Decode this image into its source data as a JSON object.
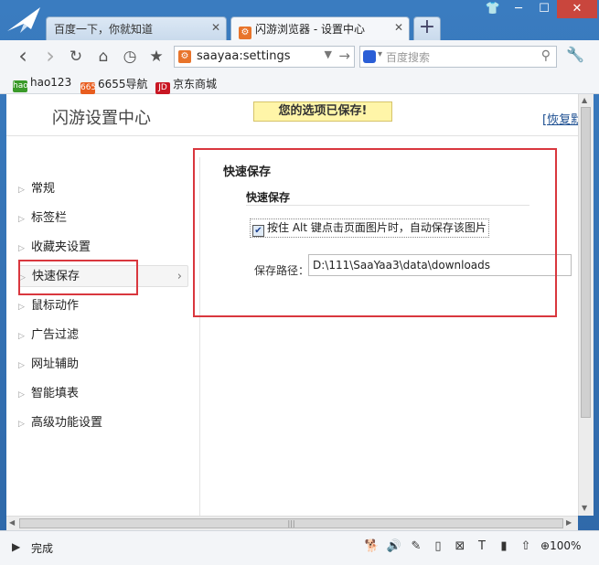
{
  "tabs": [
    {
      "label": "百度一下，你就知道",
      "active": false
    },
    {
      "label": "闪游浏览器 - 设置中心",
      "active": true
    }
  ],
  "new_tab_label": "+",
  "window_buttons": {
    "skin": "👕",
    "minimize": "─",
    "maximize": "☐",
    "close": "✕"
  },
  "nav": {
    "back": "‹",
    "forward": "›",
    "refresh": "↻",
    "home": "⌂",
    "history": "◷",
    "favorite": "★",
    "url": "saayaa:settings",
    "url_dropdown": "▼",
    "go": "→",
    "search_placeholder": "百度搜索",
    "tools": "🔧"
  },
  "bookmarks": [
    {
      "label": "hao123",
      "icon": "hao",
      "color": "#3a9a2a"
    },
    {
      "label": "6655导航",
      "icon": "6655",
      "color": "#e85d1f"
    },
    {
      "label": "京东商城",
      "icon": "JD",
      "color": "#c81623"
    }
  ],
  "page": {
    "title": "闪游设置中心",
    "saved_notice": "您的选项已保存!",
    "restore_link": "[恢复默认]"
  },
  "menu": [
    {
      "label": "常规",
      "active": false
    },
    {
      "label": "标签栏",
      "active": false
    },
    {
      "label": "收藏夹设置",
      "active": false
    },
    {
      "label": "快速保存",
      "active": true
    },
    {
      "label": "鼠标动作",
      "active": false
    },
    {
      "label": "广告过滤",
      "active": false
    },
    {
      "label": "网址辅助",
      "active": false
    },
    {
      "label": "智能填表",
      "active": false
    },
    {
      "label": "高级功能设置",
      "active": false
    }
  ],
  "quick_save": {
    "section_title": "快速保存",
    "subsection_title": "快速保存",
    "checkbox_label": "按住 Alt 键点击页面图片时，自动保存该图片",
    "checkbox_checked": true,
    "path_label": "保存路径：",
    "path_value": "D:\\111\\SaaYaa3\\data\\downloads"
  },
  "status": {
    "text": "完成",
    "zoom": "100%"
  },
  "colors": {
    "highlight_box": "#d9373e",
    "notice_bg": "#fff5a8",
    "frame": "#2f6fb0"
  }
}
